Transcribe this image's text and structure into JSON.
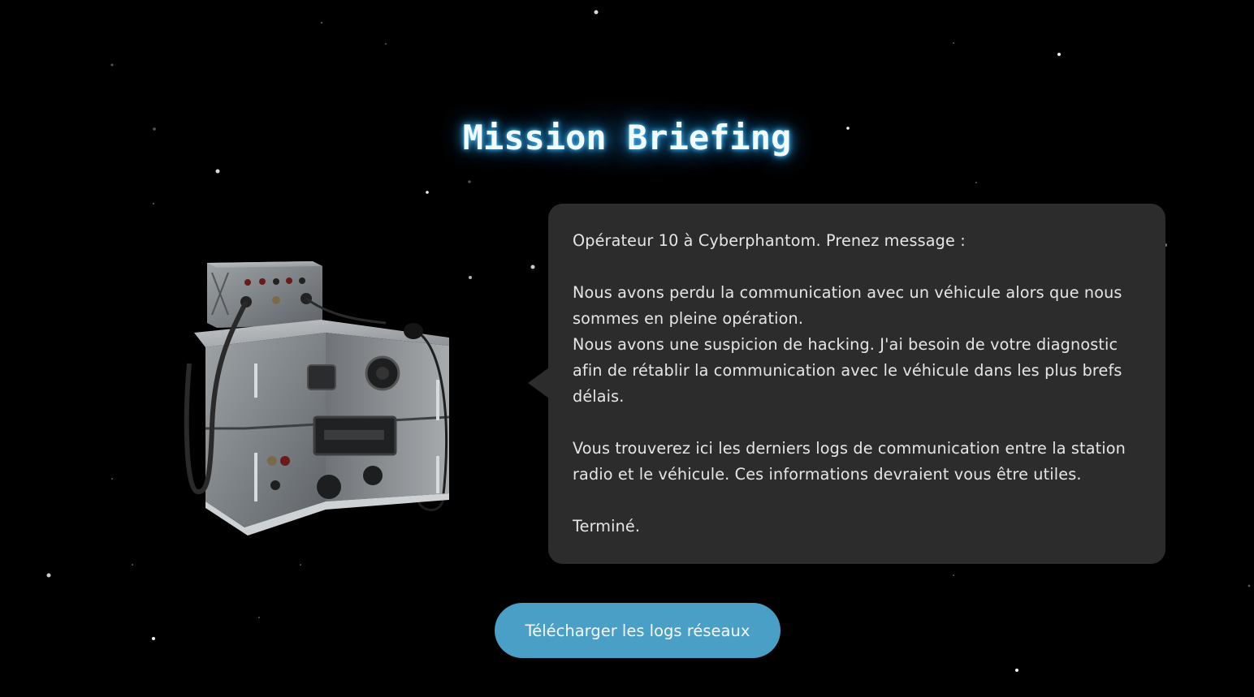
{
  "page": {
    "title": "Mission Briefing",
    "background": "#000000",
    "title_glow_color": "#4cc3ff"
  },
  "radio": {
    "image_name": "field-radio-station-image"
  },
  "message": {
    "greeting": "Opérateur 10 à Cyberphantom. Prenez message :",
    "para1_line1": "Nous avons perdu la communication avec un véhicule alors que nous sommes en pleine opération.",
    "para1_line2": "Nous avons une suspicion de hacking. J'ai besoin de votre diagnostic afin de rétablir la communication avec le véhicule dans les plus brefs délais.",
    "para2": "Vous trouverez ici les derniers logs de communication entre la station radio et le véhicule. Ces informations devraient vous être utiles.",
    "signoff": "Terminé."
  },
  "actions": {
    "download_label": "Télécharger les logs réseaux",
    "button_color": "#4a9fc6"
  }
}
